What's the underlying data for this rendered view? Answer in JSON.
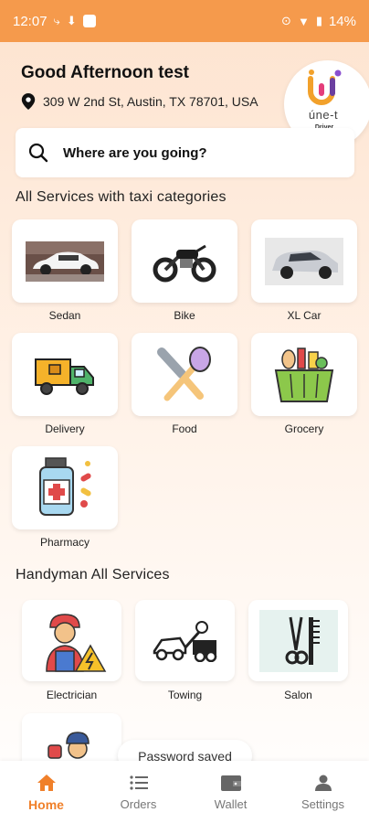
{
  "status_bar": {
    "time": "12:07",
    "battery": "14%"
  },
  "header": {
    "greeting": "Good Afternoon test",
    "address": "309 W 2nd St, Austin, TX 78701, USA",
    "logo_text": "úne-t",
    "logo_subtext": "Driver"
  },
  "search": {
    "placeholder": "Where are you going?"
  },
  "taxi_section": {
    "title": "All Services with taxi categories",
    "items": [
      {
        "label": "Sedan",
        "icon": "sedan-car-photo"
      },
      {
        "label": "Bike",
        "icon": "motorbike-photo"
      },
      {
        "label": "XL Car",
        "icon": "xl-car-photo"
      },
      {
        "label": "Delivery",
        "icon": "delivery-truck-icon"
      },
      {
        "label": "Food",
        "icon": "food-utensils-icon"
      },
      {
        "label": "Grocery",
        "icon": "grocery-basket-icon"
      },
      {
        "label": "Pharmacy",
        "icon": "pharmacy-bottle-icon"
      }
    ]
  },
  "handyman_section": {
    "title": "Handyman All Services",
    "items": [
      {
        "label": "Electrician",
        "icon": "electrician-icon"
      },
      {
        "label": "Towing",
        "icon": "towing-truck-icon"
      },
      {
        "label": "Salon",
        "icon": "salon-scissors-icon"
      }
    ]
  },
  "toast": {
    "message": "Password saved"
  },
  "bottom_nav": {
    "items": [
      {
        "label": "Home",
        "icon": "home-icon",
        "active": true
      },
      {
        "label": "Orders",
        "icon": "list-icon",
        "active": false
      },
      {
        "label": "Wallet",
        "icon": "wallet-icon",
        "active": false
      },
      {
        "label": "Settings",
        "icon": "person-icon",
        "active": false
      }
    ]
  },
  "colors": {
    "accent": "#f59a4c",
    "active_nav": "#f0802a"
  }
}
